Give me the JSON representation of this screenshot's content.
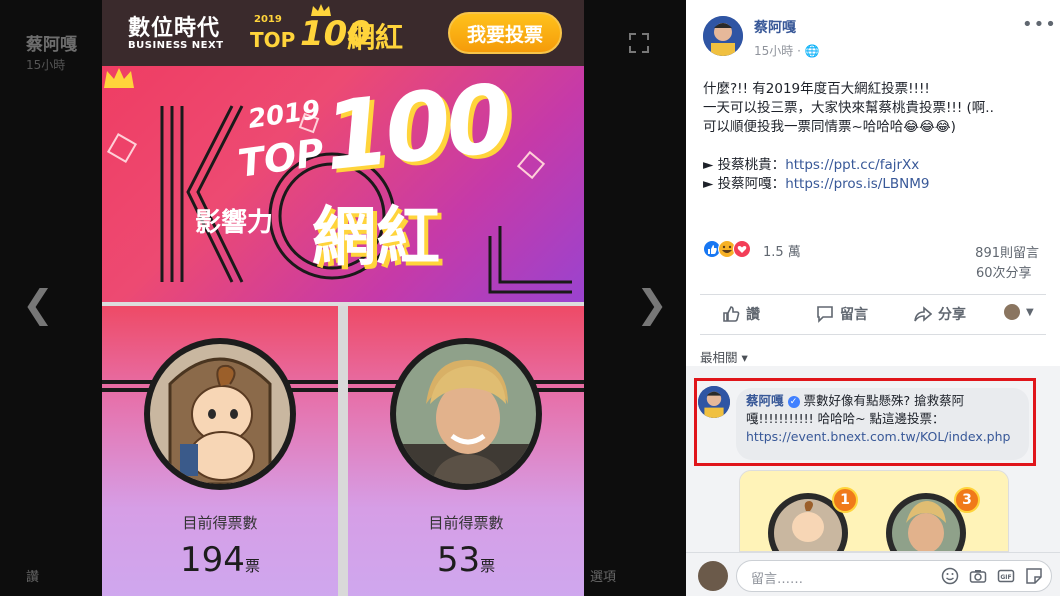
{
  "viewer": {
    "ghost_name": "蔡阿嘎",
    "ghost_sub": "15小時",
    "bottom_items": [
      "讚",
      "留言",
      "分享",
      "選項"
    ]
  },
  "poster": {
    "logo_main": "數位時代",
    "logo_sub": "BUSINESS NEXT",
    "header_year": "2019",
    "header_top": "TOP",
    "header_100": "100",
    "header_kol": "網紅",
    "vote_button": "我要投票",
    "banner_year": "2019",
    "banner_top": "TOP",
    "banner_100": "100",
    "banner_influence": "影響力",
    "banner_kol": "網紅",
    "cards": [
      {
        "label": "目前得票數",
        "count": "194",
        "unit": "票"
      },
      {
        "label": "目前得票數",
        "count": "53",
        "unit": "票"
      }
    ]
  },
  "post": {
    "author": "蔡阿嘎",
    "time": "15小時",
    "lines": [
      "什麼?!! 有2019年度百大網紅投票!!!!",
      "一天可以投三票，大家快來幫蔡桃貴投票!!! (啊..",
      "可以順便投我一票同情票~哈哈哈😂😂😂)"
    ],
    "link1_prefix": "► 投蔡桃貴：",
    "link1_url": "https://ppt.cc/fajrXx",
    "link2_prefix": "► 投蔡阿嘎：",
    "link2_url": "https://pros.is/LBNM9",
    "reaction_count": "1.5 萬",
    "comments_count": "891則留言",
    "shares_count": "60次分享",
    "actions": {
      "like": "讚",
      "comment": "留言",
      "share": "分享"
    },
    "relevance": "最相關 ▾"
  },
  "comment": {
    "author": "蔡阿嘎",
    "text": "票數好像有點懸殊? 搶救蔡阿嘎!!!!!!!!!!! 哈哈哈~ 點這邊投票：",
    "url": "https://event.bnext.com.tw/KOL/index.php",
    "badge1": "1",
    "badge2": "3"
  },
  "composer": {
    "placeholder": "留言……"
  },
  "colors": {
    "fb_blue": "#385898",
    "highlight_red": "#e0151a",
    "gold": "#ffd43b"
  }
}
